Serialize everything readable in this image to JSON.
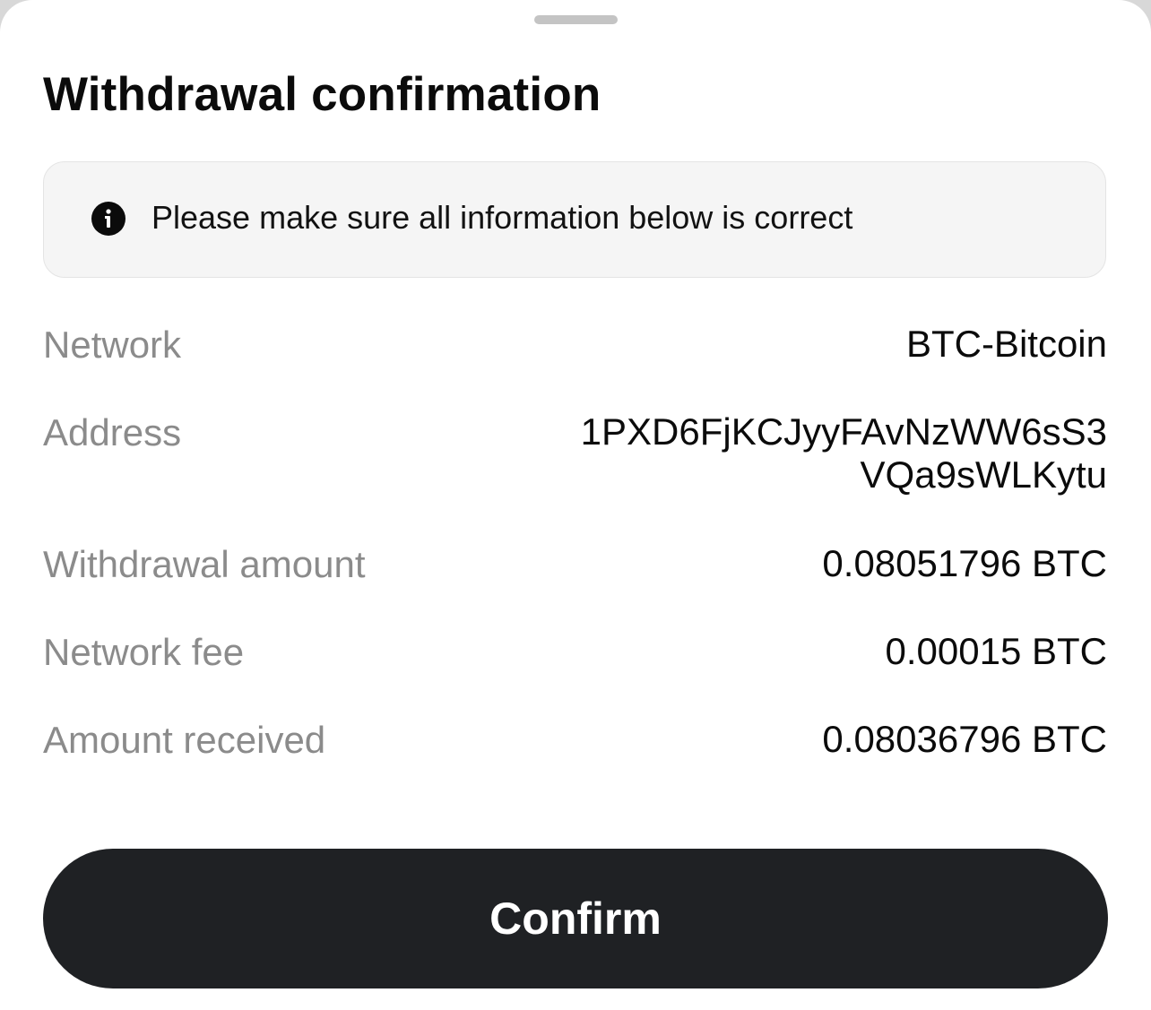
{
  "title": "Withdrawal confirmation",
  "notice": {
    "icon": "info-icon",
    "text": "Please make sure all information below is correct"
  },
  "details": {
    "network": {
      "label": "Network",
      "value": "BTC-Bitcoin"
    },
    "address": {
      "label": "Address",
      "value": "1PXD6FjKCJyyFAvNzWW6sS3VQa9sWLKytu"
    },
    "withdrawal_amount": {
      "label": "Withdrawal amount",
      "value": "0.08051796 BTC"
    },
    "network_fee": {
      "label": "Network fee",
      "value": "0.00015 BTC"
    },
    "amount_received": {
      "label": "Amount received",
      "value": "0.08036796 BTC"
    }
  },
  "confirm_label": "Confirm",
  "colors": {
    "button_bg": "#1f2124",
    "notice_bg": "#f5f5f5",
    "label_text": "#8b8b8b",
    "value_text": "#0b0b0b"
  }
}
